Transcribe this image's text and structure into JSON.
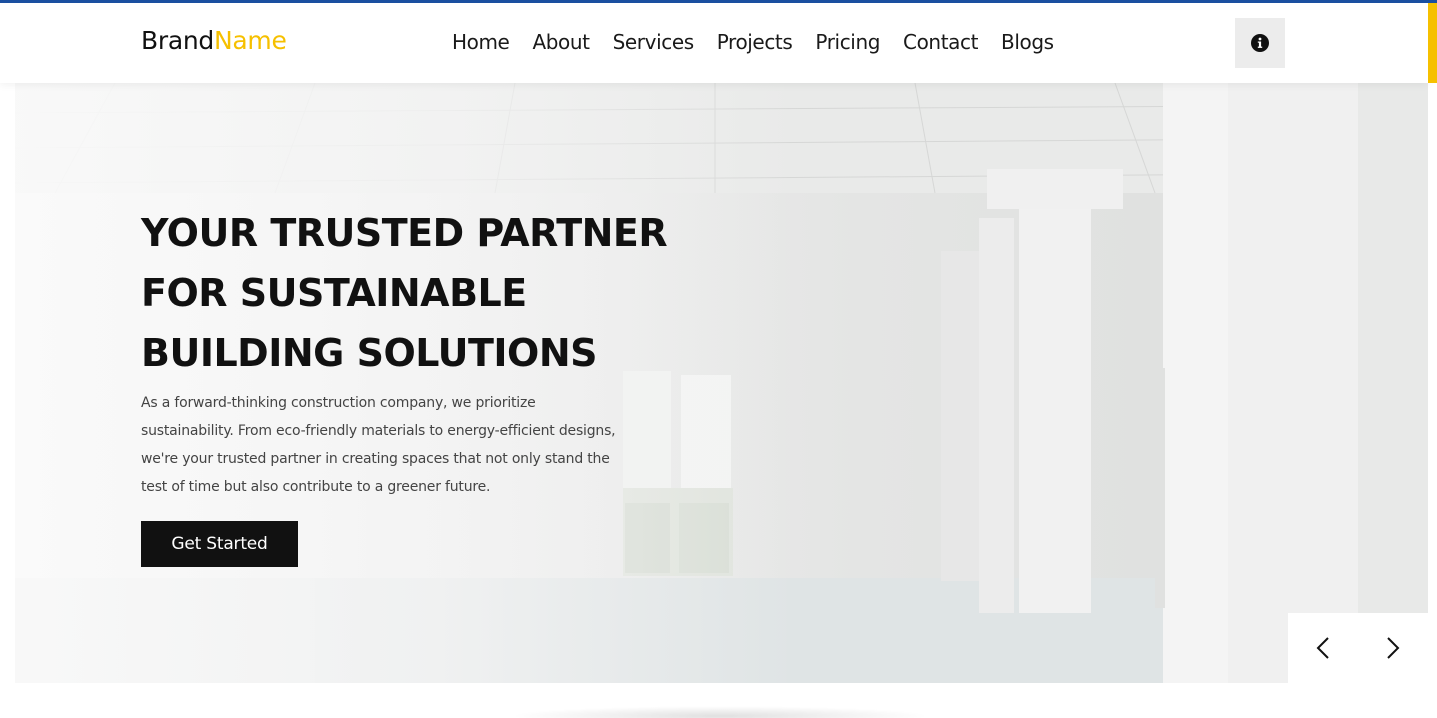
{
  "colors": {
    "accent_blue": "#1a4fa0",
    "accent_yellow": "#f6c000",
    "dark": "#111111"
  },
  "brand": {
    "part1": "Brand",
    "part2": "Name"
  },
  "nav": {
    "items": [
      "Home",
      "About",
      "Services",
      "Projects",
      "Pricing",
      "Contact",
      "Blogs"
    ]
  },
  "header": {
    "info_icon": "info-circle-icon"
  },
  "hero": {
    "title_lines": [
      "YOUR TRUSTED PARTNER",
      "FOR SUSTAINABLE",
      "BUILDING SOLUTIONS"
    ],
    "description_lines": [
      "As a forward-thinking construction company, we prioritize",
      "sustainability. From eco-friendly materials to energy-efficient designs,",
      "we're your trusted partner in creating spaces that not only stand the",
      "test of time but also contribute to a greener future."
    ],
    "cta_label": "Get Started",
    "prev_icon": "chevron-left-icon",
    "next_icon": "chevron-right-icon"
  }
}
